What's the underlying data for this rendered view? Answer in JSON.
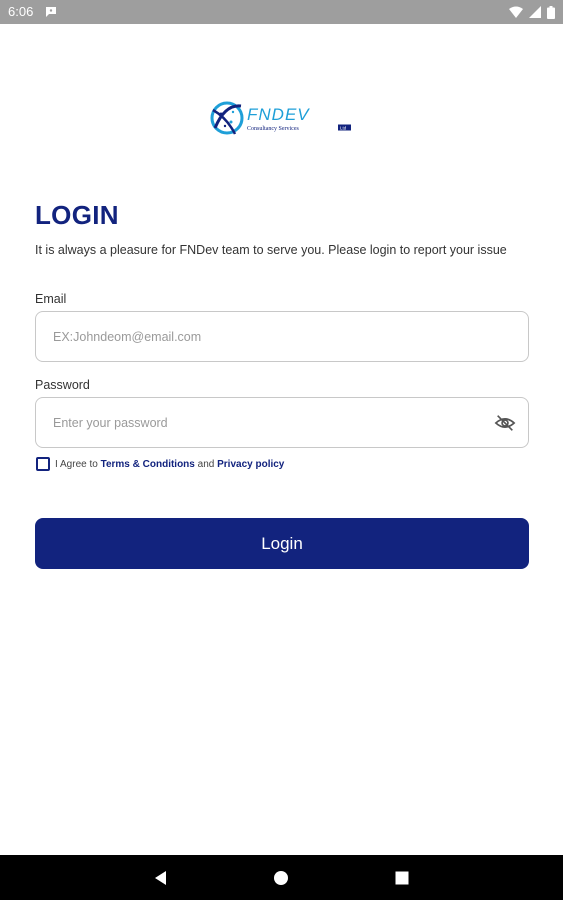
{
  "status_bar": {
    "time": "6:06",
    "icons": [
      "message-icon",
      "wifi-icon",
      "signal-icon",
      "battery-icon"
    ]
  },
  "logo": {
    "brand": "FNDEV",
    "tagline": "Consultancy Services",
    "suffix": "Ltd"
  },
  "login": {
    "title": "LOGIN",
    "subtitle": "It is always a pleasure for FNDev team to serve you. Please login to report your issue",
    "email_label": "Email",
    "email_placeholder": "EX:Johndeom@email.com",
    "email_value": "",
    "password_label": "Password",
    "password_placeholder": "Enter your password",
    "password_value": "",
    "password_toggle_icon": "eye-off-icon",
    "agree_prefix": "I Agree to ",
    "terms_link": "Terms & Conditions",
    "agree_and": " and ",
    "privacy_link": "Privacy policy",
    "agree_checked": false,
    "button_label": "Login"
  },
  "nav_bar": {
    "icons": [
      "back-icon",
      "home-icon",
      "recents-icon"
    ]
  },
  "colors": {
    "primary": "#12237e",
    "accent_light": "#1e9fd8",
    "status_bar": "#9e9e9e",
    "nav_bar": "#000000",
    "field_border": "#c8c8c8"
  }
}
